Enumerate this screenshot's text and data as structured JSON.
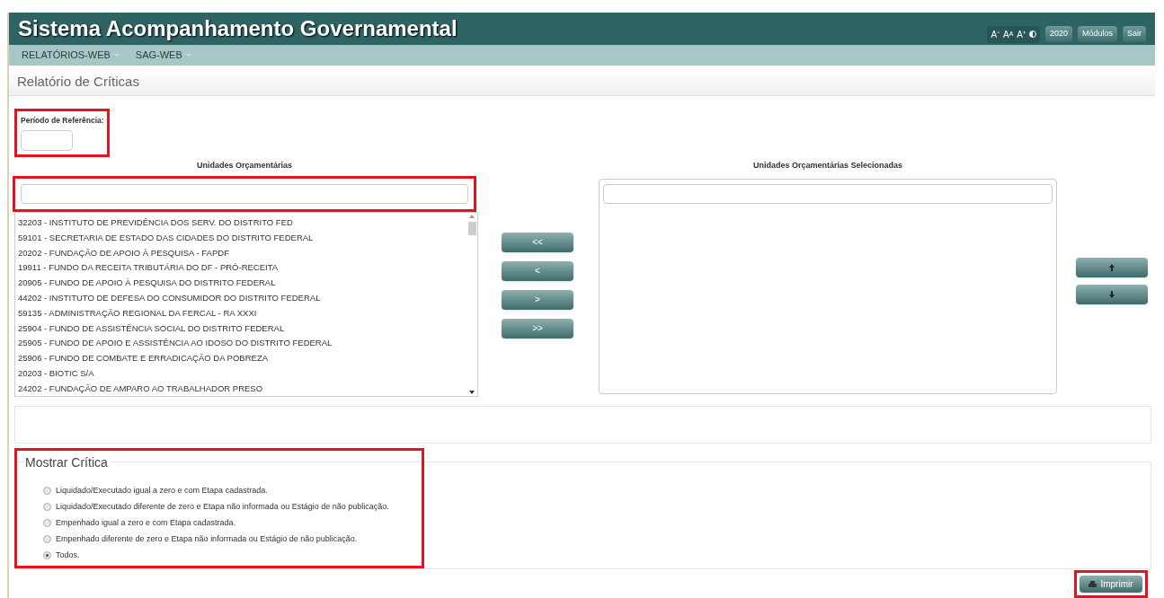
{
  "header": {
    "title": "Sistema Acompanhamento Governamental",
    "font_buttons": [
      "A⁻",
      "Aᴬ",
      "A⁺"
    ],
    "buttons": [
      "2020",
      "Módulos",
      "Sair"
    ]
  },
  "menu": [
    {
      "label": "RELATÓRIOS-WEB"
    },
    {
      "label": "SAG-WEB"
    }
  ],
  "page_title": "Relatório de Críticas",
  "periodo": {
    "label": "Período de Referência:"
  },
  "unidades": {
    "title": "Unidades Orçamentárias",
    "items": [
      "32203 - INSTITUTO DE PREVIDÊNCIA DOS SERV. DO DISTRITO FED",
      "59101 - SECRETARIA DE ESTADO DAS CIDADES DO DISTRITO FEDERAL",
      "20202 - FUNDAÇÃO DE APOIO À PESQUISA - FAPDF",
      "19911 - FUNDO DA RECEITA TRIBUTÁRIA DO DF - PRÓ-RECEITA",
      "20905 - FUNDO DE APOIO À PESQUISA DO DISTRITO FEDERAL",
      "44202 - INSTITUTO DE DEFESA DO CONSUMIDOR DO DISTRITO FEDERAL",
      "59135 - ADMINISTRAÇÃO REGIONAL DA FERCAL - RA XXXI",
      "25904 - FUNDO DE ASSISTÊNCIA SOCIAL DO DISTRITO FEDERAL",
      "25905 - FUNDO DE APOIO E ASSISTÊNCIA AO IDOSO DO DISTRITO FEDERAL",
      "25906 - FUNDO DE COMBATE E ERRADICAÇÃO DA POBREZA",
      "20203 - BIOTIC S/A",
      "24202 - FUNDAÇÃO DE AMPARO AO TRABALHADOR PRESO"
    ]
  },
  "transfer_buttons": [
    "<<",
    "<",
    ">",
    ">>"
  ],
  "selecionadas": {
    "title": "Unidades Orçamentárias Selecionadas"
  },
  "mostrar_critica": {
    "legend": "Mostrar Crítica",
    "options": [
      {
        "label": "Liquidado/Executado igual a zero e com Etapa cadastrada.",
        "selected": false
      },
      {
        "label": "Liquidado/Executado diferente de zero e Etapa não informada ou Estágio de não publicação.",
        "selected": false
      },
      {
        "label": "Empenhado igual a zero e com Etapa cadastrada.",
        "selected": false
      },
      {
        "label": "Empenhado diferente de zero e Etapa não informada ou Estágio de não publicação.",
        "selected": false
      },
      {
        "label": "Todos.",
        "selected": true
      }
    ]
  },
  "print_button": "Imprimir"
}
